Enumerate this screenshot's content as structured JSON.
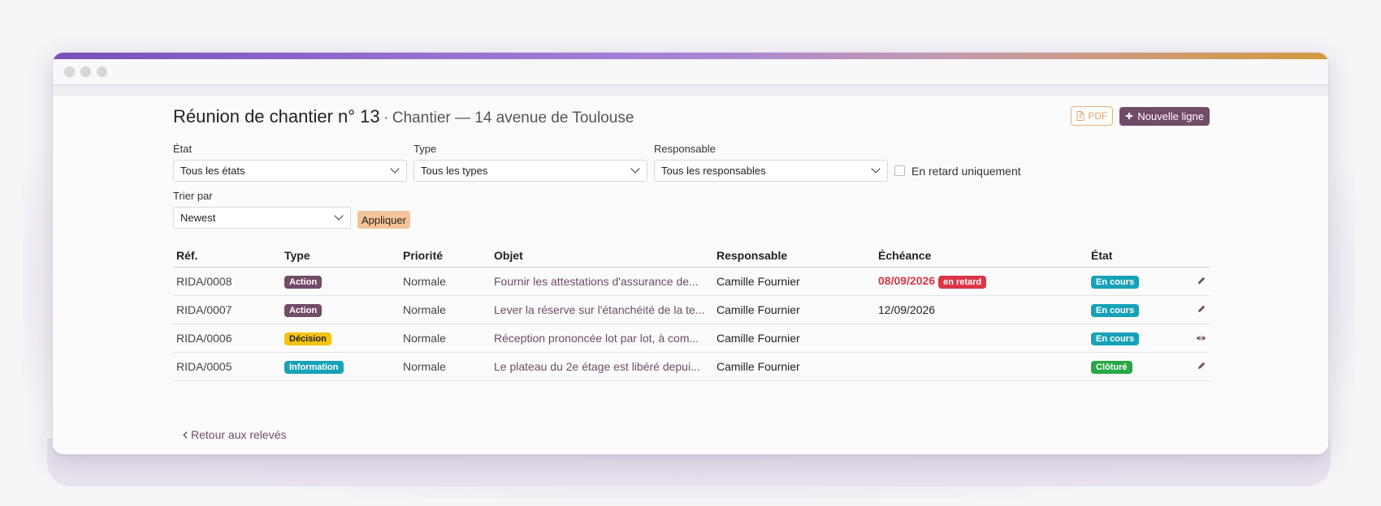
{
  "header": {
    "title": "Réunion de chantier n° 13",
    "separator": "·",
    "subtitle": "Chantier — 14 avenue de Toulouse",
    "pdf_label": "PDF",
    "new_line_label": "Nouvelle ligne"
  },
  "filters": {
    "state_label": "État",
    "state_value": "Tous les états",
    "type_label": "Type",
    "type_value": "Tous les types",
    "owner_label": "Responsable",
    "owner_value": "Tous les responsables",
    "late_only_label": "En retard uniquement",
    "sort_label": "Trier par",
    "sort_value": "Newest",
    "apply_label": "Appliquer"
  },
  "table": {
    "columns": [
      "Réf.",
      "Type",
      "Priorité",
      "Objet",
      "Responsable",
      "Échéance",
      "État"
    ],
    "rows": [
      {
        "ref": "RIDA/0008",
        "type": "Action",
        "priority": "Normale",
        "object": "Fournir les attestations d'assurance de...",
        "owner": "Camille Fournier",
        "due": "08/09/2026",
        "late_badge": "en retard",
        "state": "En cours"
      },
      {
        "ref": "RIDA/0007",
        "type": "Action",
        "priority": "Normale",
        "object": "Lever la réserve sur l'étanchéité de la te...",
        "owner": "Camille Fournier",
        "due": "12/09/2026",
        "late_badge": "",
        "state": "En cours"
      },
      {
        "ref": "RIDA/0006",
        "type": "Décision",
        "priority": "Normale",
        "object": "Réception prononcée lot par lot, à com...",
        "owner": "Camille Fournier",
        "due": "",
        "late_badge": "",
        "state": "En cours"
      },
      {
        "ref": "RIDA/0005",
        "type": "Information",
        "priority": "Normale",
        "object": "Le plateau du 2e étage est libéré depui...",
        "owner": "Camille Fournier",
        "due": "",
        "late_badge": "",
        "state": "Clôturé"
      }
    ]
  },
  "footer": {
    "back_label": "Retour aux relevés"
  },
  "icons": [
    "file-pdf-icon",
    "plus-icon",
    "chevron-down-icon",
    "pencil-icon",
    "eye-icon",
    "chevron-left-icon"
  ],
  "colors": {
    "brand": "#714b67",
    "info": "#17a2b8",
    "success": "#28a745",
    "danger": "#dc3545",
    "warning": "#f4c20d",
    "pdf": "#e0a36a"
  }
}
